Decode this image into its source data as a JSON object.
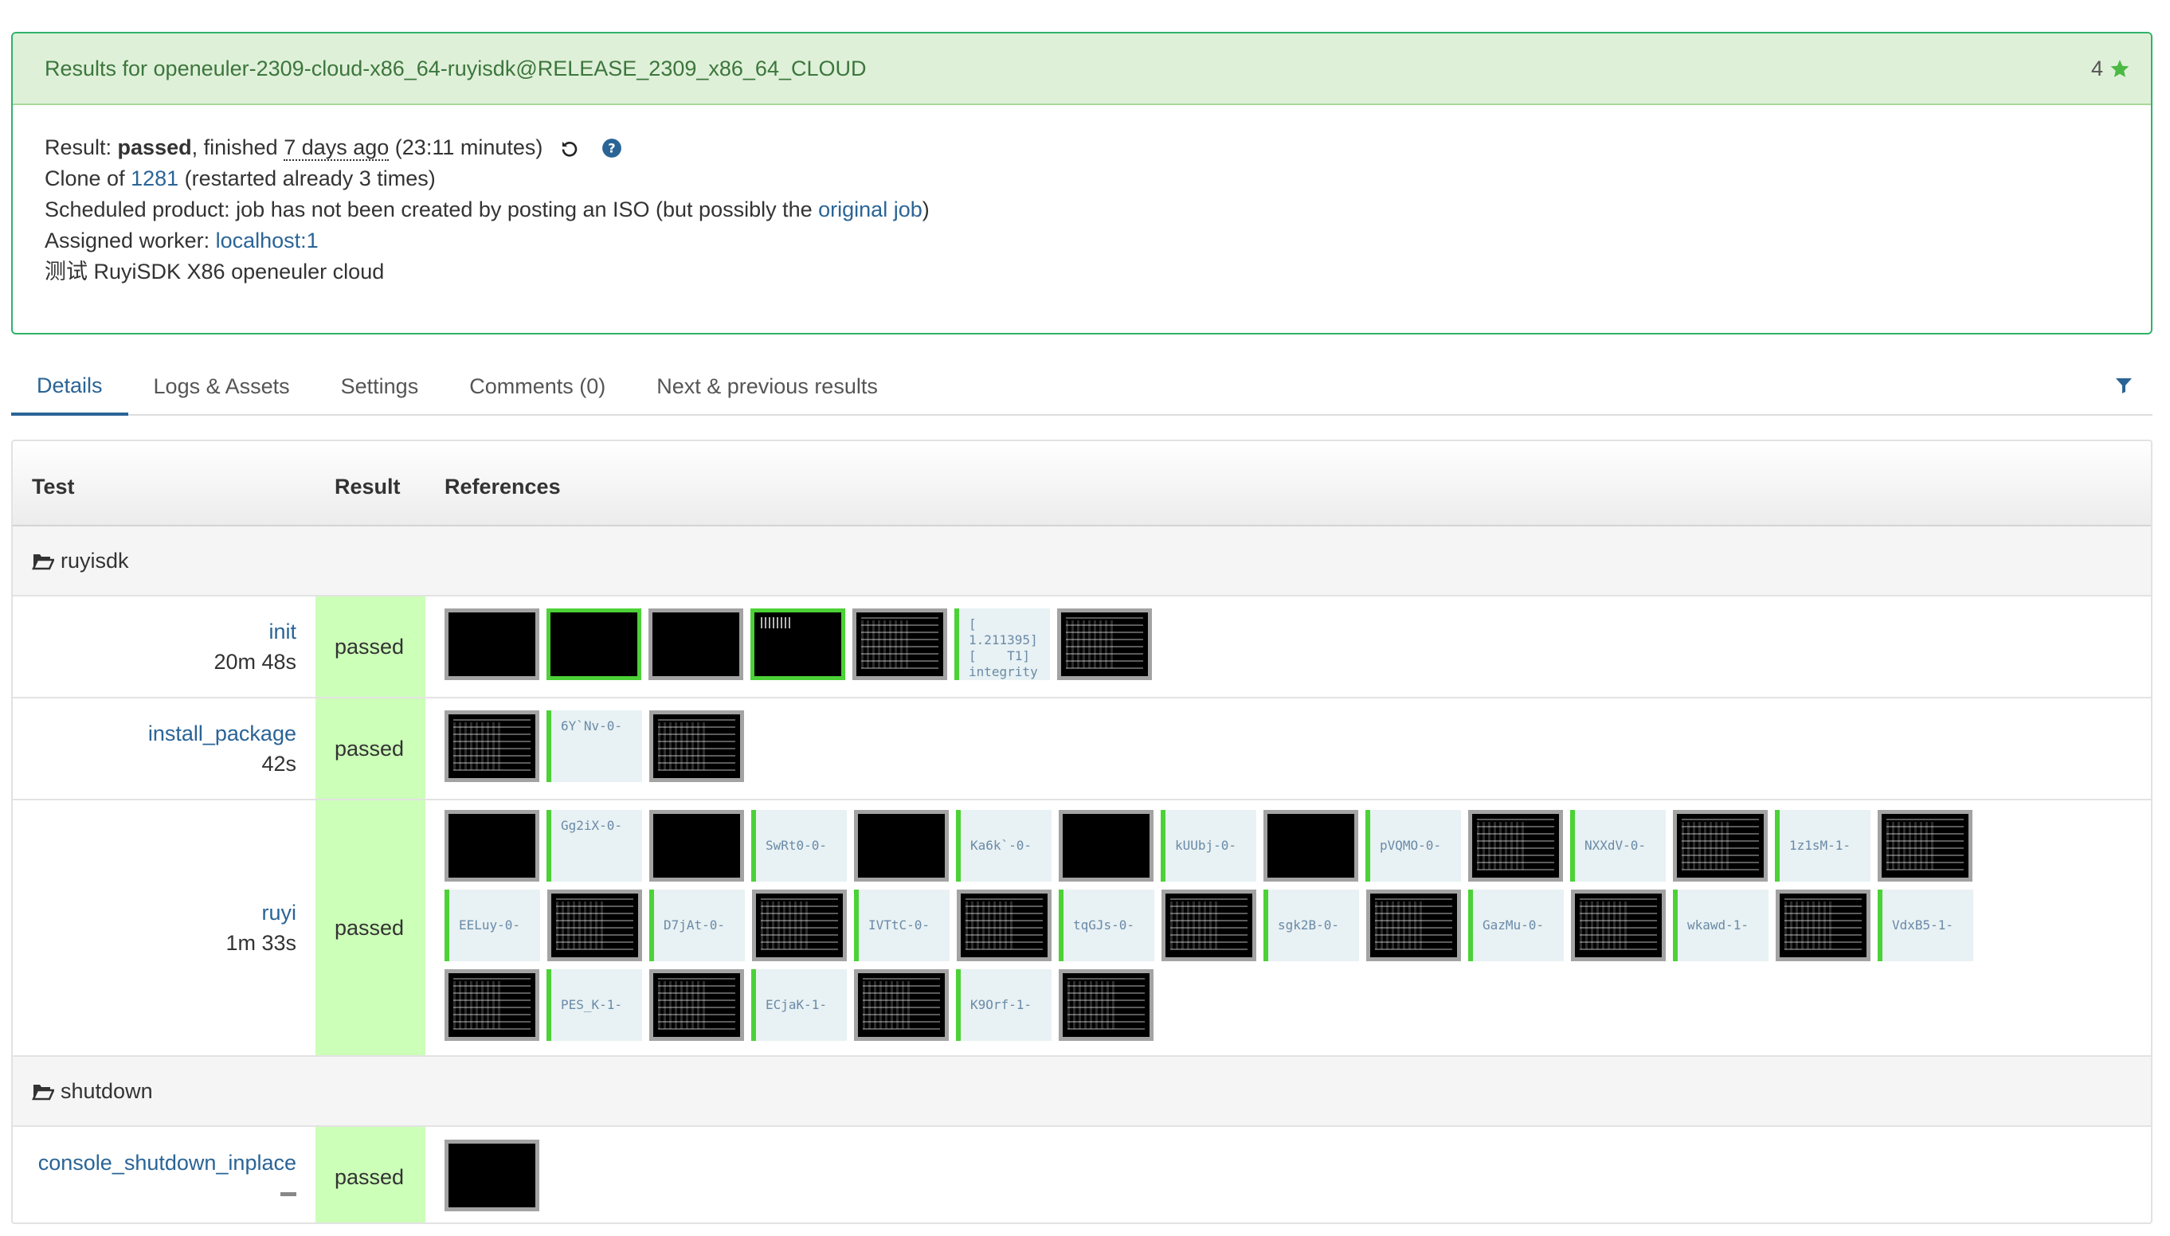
{
  "summary": {
    "title": "Results for openeuler-2309-cloud-x86_64-ruyisdk@RELEASE_2309_x86_64_CLOUD",
    "star_count": "4",
    "result_label": "Result: ",
    "result_value": "passed",
    "finished_prefix": ", finished ",
    "finished_ago": "7 days ago",
    "duration": " (23:11 minutes)",
    "clone_prefix": "Clone of ",
    "clone_id": "1281",
    "clone_suffix": " (restarted already 3 times)",
    "scheduled_prefix": "Scheduled product: job has not been created by posting an ISO (but possibly the ",
    "original_job_link": "original job",
    "scheduled_suffix": ")",
    "worker_prefix": "Assigned worker: ",
    "worker_link": "localhost:1",
    "description": "测试 RuyiSDK X86 openeuler cloud"
  },
  "tabs": [
    "Details",
    "Logs & Assets",
    "Settings",
    "Comments (0)",
    "Next & previous results"
  ],
  "table": {
    "headers": {
      "test": "Test",
      "result": "Result",
      "references": "References"
    },
    "groups": [
      {
        "name": "ruyisdk",
        "rows": [
          {
            "test": "init",
            "duration": "20m 48s",
            "result": "passed",
            "refs": [
              {
                "k": "shot"
              },
              {
                "k": "shot",
                "ok": true
              },
              {
                "k": "shot"
              },
              {
                "k": "shot",
                "ok": true,
                "speck": true
              },
              {
                "k": "shot",
                "txt": true
              },
              {
                "k": "log",
                "text": "[\n1.211395]\n[    T1]\nintegrity"
              },
              {
                "k": "shot",
                "txt": true
              }
            ]
          },
          {
            "test": "install_package",
            "duration": "42s",
            "result": "passed",
            "refs": [
              {
                "k": "shot",
                "txt": true
              },
              {
                "k": "log",
                "text": "6Y`Nv-0-"
              },
              {
                "k": "shot",
                "txt": true
              }
            ]
          },
          {
            "test": "ruyi",
            "duration": "1m 33s",
            "result": "passed",
            "refs": [
              {
                "k": "shot"
              },
              {
                "k": "log",
                "text": "Gg2iX-0-"
              },
              {
                "k": "shot"
              },
              {
                "k": "log",
                "text": "SwRt0-0-",
                "mid": true
              },
              {
                "k": "shot"
              },
              {
                "k": "log",
                "text": "Ka6k`-0-",
                "mid": true
              },
              {
                "k": "shot"
              },
              {
                "k": "log",
                "text": "kUUbj-0-",
                "mid": true
              },
              {
                "k": "shot"
              },
              {
                "k": "log",
                "text": "pVQMO-0-",
                "mid": true
              },
              {
                "k": "shot",
                "txt": true
              },
              {
                "k": "log",
                "text": "NXXdV-0-",
                "mid": true
              },
              {
                "k": "shot",
                "txt": true
              },
              {
                "k": "log",
                "text": "1z1sM-1-",
                "mid": true
              },
              {
                "k": "shot",
                "txt": true
              },
              {
                "k": "log",
                "text": "EELuy-0-",
                "mid": true
              },
              {
                "k": "shot",
                "txt": true
              },
              {
                "k": "log",
                "text": "D7jAt-0-",
                "mid": true
              },
              {
                "k": "shot",
                "txt": true
              },
              {
                "k": "log",
                "text": "IVTtC-0-",
                "mid": true
              },
              {
                "k": "shot",
                "txt": true
              },
              {
                "k": "log",
                "text": "tqGJs-0-",
                "mid": true
              },
              {
                "k": "shot",
                "txt": true
              },
              {
                "k": "log",
                "text": "sgk2B-0-",
                "mid": true
              },
              {
                "k": "shot",
                "txt": true
              },
              {
                "k": "log",
                "text": "GazMu-0-",
                "mid": true
              },
              {
                "k": "shot",
                "txt": true
              },
              {
                "k": "log",
                "text": "wkawd-1-",
                "mid": true
              },
              {
                "k": "shot",
                "txt": true
              },
              {
                "k": "log",
                "text": "VdxB5-1-",
                "mid": true
              },
              {
                "k": "shot",
                "txt": true
              },
              {
                "k": "log",
                "text": "PES_K-1-",
                "mid": true
              },
              {
                "k": "shot",
                "txt": true
              },
              {
                "k": "log",
                "text": "ECjaK-1-",
                "mid": true
              },
              {
                "k": "shot",
                "txt": true
              },
              {
                "k": "log",
                "text": "K9Orf-1-",
                "mid": true
              },
              {
                "k": "shot",
                "txt": true
              }
            ]
          }
        ]
      },
      {
        "name": "shutdown",
        "rows": [
          {
            "test": "console_shutdown_inplace",
            "duration": "",
            "no_duration": true,
            "result": "passed",
            "refs": [
              {
                "k": "shot"
              }
            ]
          }
        ]
      }
    ]
  },
  "colors": {
    "accent": "#2a6496",
    "passed_bg": "#ccffb8",
    "panel_border": "#2fb36a",
    "panel_head": "#dff0d8",
    "ok_border": "#4cd137"
  },
  "icons": {
    "star": "star-icon",
    "restart": "restart-icon",
    "help": "help-icon",
    "filter": "filter-icon",
    "folder": "folder-open-icon"
  }
}
